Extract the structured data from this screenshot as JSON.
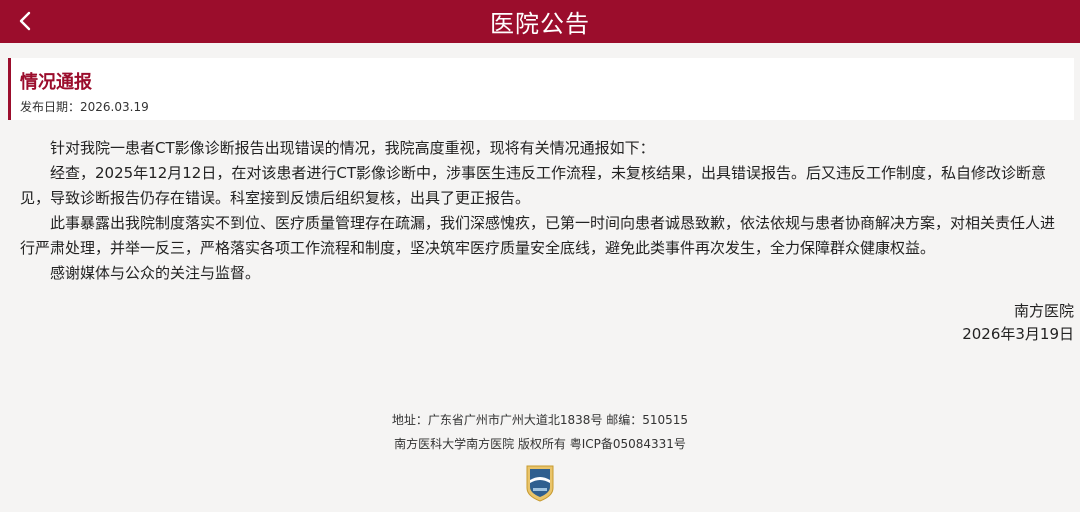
{
  "header": {
    "title": "医院公告",
    "back_icon": "chevron-left-icon"
  },
  "notice": {
    "title": "情况通报",
    "publish_date": "发布日期：2026.03.19"
  },
  "body": {
    "paragraphs": [
      "针对我院一患者CT影像诊断报告出现错误的情况，我院高度重视，现将有关情况通报如下：",
      "经查，2025年12月12日，在对该患者进行CT影像诊断中，涉事医生违反工作流程，未复核结果，出具错误报告。后又违反工作制度，私自修改诊断意见，导致诊断报告仍存在错误。科室接到反馈后组织复核，出具了更正报告。",
      "此事暴露出我院制度落实不到位、医疗质量管理存在疏漏，我们深感愧疚，已第一时间向患者诚恳致歉，依法依规与患者协商解决方案，对相关责任人进行严肃处理，并举一反三，严格落实各项工作流程和制度，坚决筑牢医疗质量安全底线，避免此类事件再次发生，全力保障群众健康权益。",
      "感谢媒体与公众的关注与监督。"
    ],
    "signature": "南方医院",
    "sign_date": "2026年3月19日"
  },
  "footer": {
    "address": "地址：广东省广州市广州大道北1838号 邮编：510515",
    "copyright": "南方医科大学南方医院 版权所有 粤ICP备05084331号",
    "emblem_icon": "hospital-emblem-icon"
  },
  "colors": {
    "brand": "#9b0d2c",
    "background": "#f5f4f3"
  }
}
